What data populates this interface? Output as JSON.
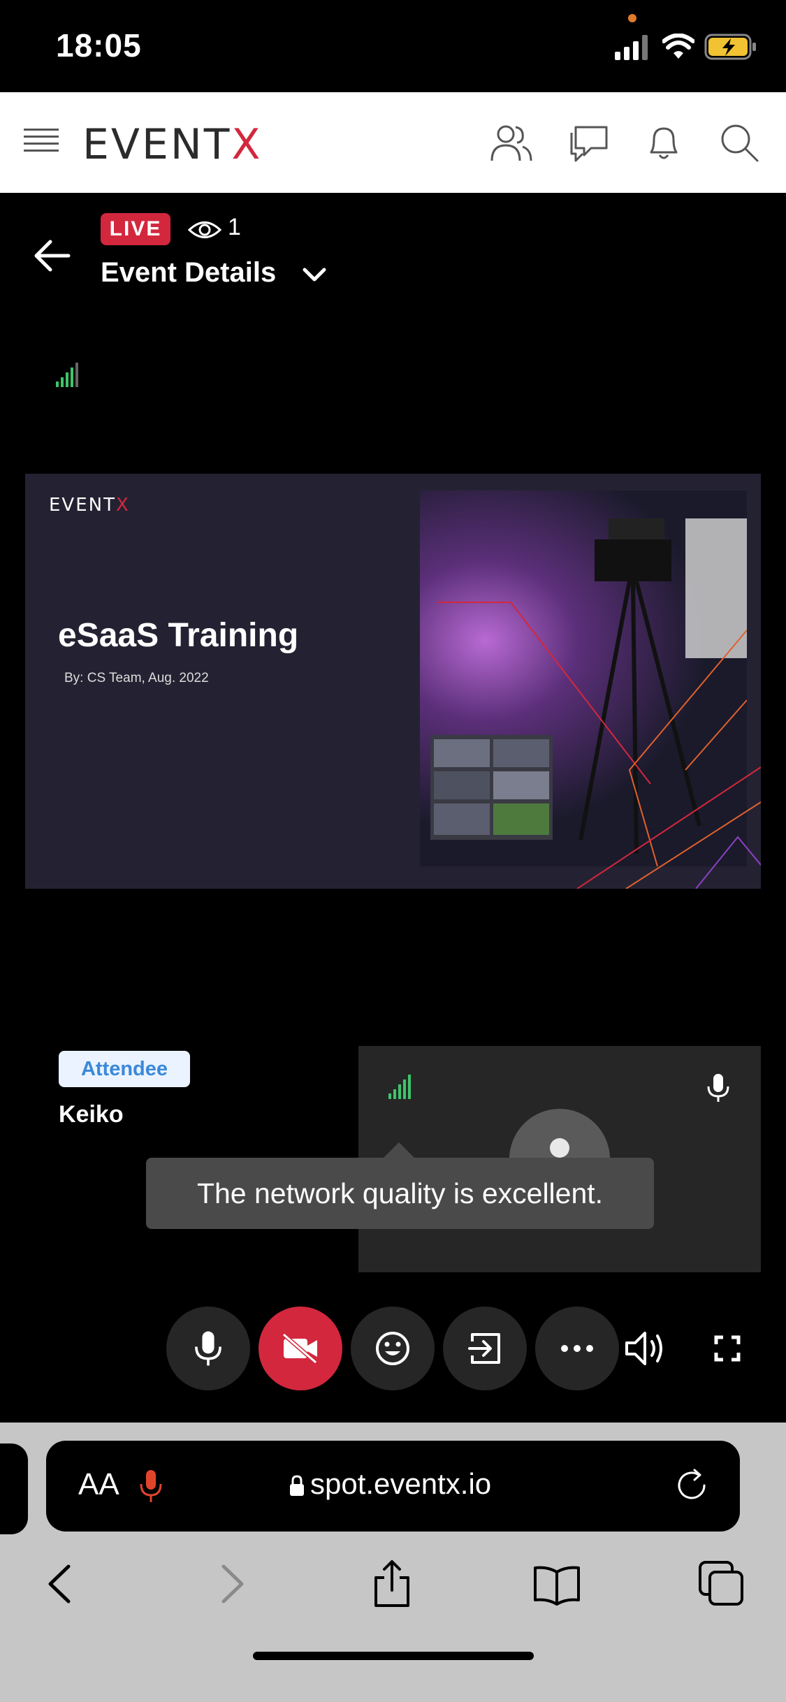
{
  "status_bar": {
    "time": "18:05"
  },
  "header": {
    "logo_main": "EVENT",
    "logo_x": "X",
    "icons": [
      "people-icon",
      "chat-icon",
      "bell-icon",
      "search-icon"
    ]
  },
  "stream": {
    "live_label": "LIVE",
    "viewer_count": "1",
    "title": "Event Details"
  },
  "slide": {
    "logo_main": "EVENT",
    "logo_x": "X",
    "title": "eSaaS Training",
    "subtitle": "By: CS Team, Aug. 2022"
  },
  "participant": {
    "role": "Attendee",
    "name": "Keiko"
  },
  "tooltip": {
    "text": "The network quality is excellent."
  },
  "controls": [
    "mic-icon",
    "camera-off-icon",
    "emoji-icon",
    "exit-icon",
    "more-icon",
    "speaker-icon",
    "fullscreen-icon"
  ],
  "browser": {
    "text_size_label": "AA",
    "url": "spot.eventx.io"
  },
  "colors": {
    "brand_red": "#d3273e",
    "signal_green": "#3fc46a",
    "tile_bg": "#262626",
    "slide_bg": "#242232"
  }
}
